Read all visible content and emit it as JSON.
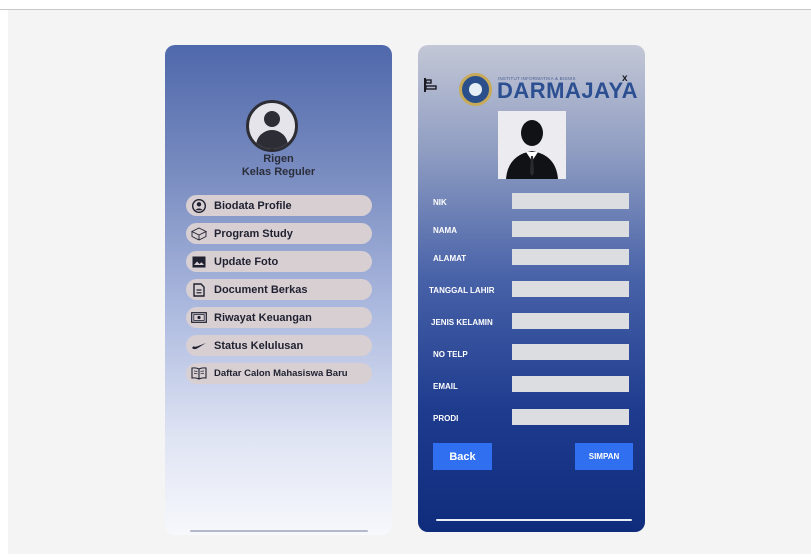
{
  "sidebar": {
    "user_name": "Rigen",
    "user_class": "Kelas Reguler",
    "items": [
      {
        "label": "Biodata Profile",
        "icon": "user-circle-icon"
      },
      {
        "label": "Program Study",
        "icon": "cube-icon"
      },
      {
        "label": "Update Foto",
        "icon": "image-icon"
      },
      {
        "label": "Document Berkas",
        "icon": "document-icon"
      },
      {
        "label": "Riwayat Keuangan",
        "icon": "money-icon"
      },
      {
        "label": "Status Kelulusan",
        "icon": "check-swoosh-icon"
      },
      {
        "label": "Daftar Calon Mahasiswa Baru",
        "icon": "book-icon"
      }
    ]
  },
  "header": {
    "brand": "DARMAJAYA",
    "brand_tagline": "INSTITUT INFORMATIKA & BISNIS",
    "close_label": "x"
  },
  "form": {
    "fields": [
      {
        "label": "NIK",
        "value": ""
      },
      {
        "label": "NAMA",
        "value": ""
      },
      {
        "label": "ALAMAT",
        "value": ""
      },
      {
        "label": "TANGGAL LAHIR",
        "value": ""
      },
      {
        "label": "JENIS KELAMIN",
        "value": ""
      },
      {
        "label": "NO TELP",
        "value": ""
      },
      {
        "label": "EMAIL",
        "value": ""
      },
      {
        "label": "PRODI",
        "value": ""
      }
    ],
    "back_label": "Back",
    "save_label": "SIMPAN"
  },
  "colors": {
    "accent_button": "#2f6ff0",
    "menu_pill": "#d8cfd3",
    "brand_blue": "#2c4f92"
  }
}
